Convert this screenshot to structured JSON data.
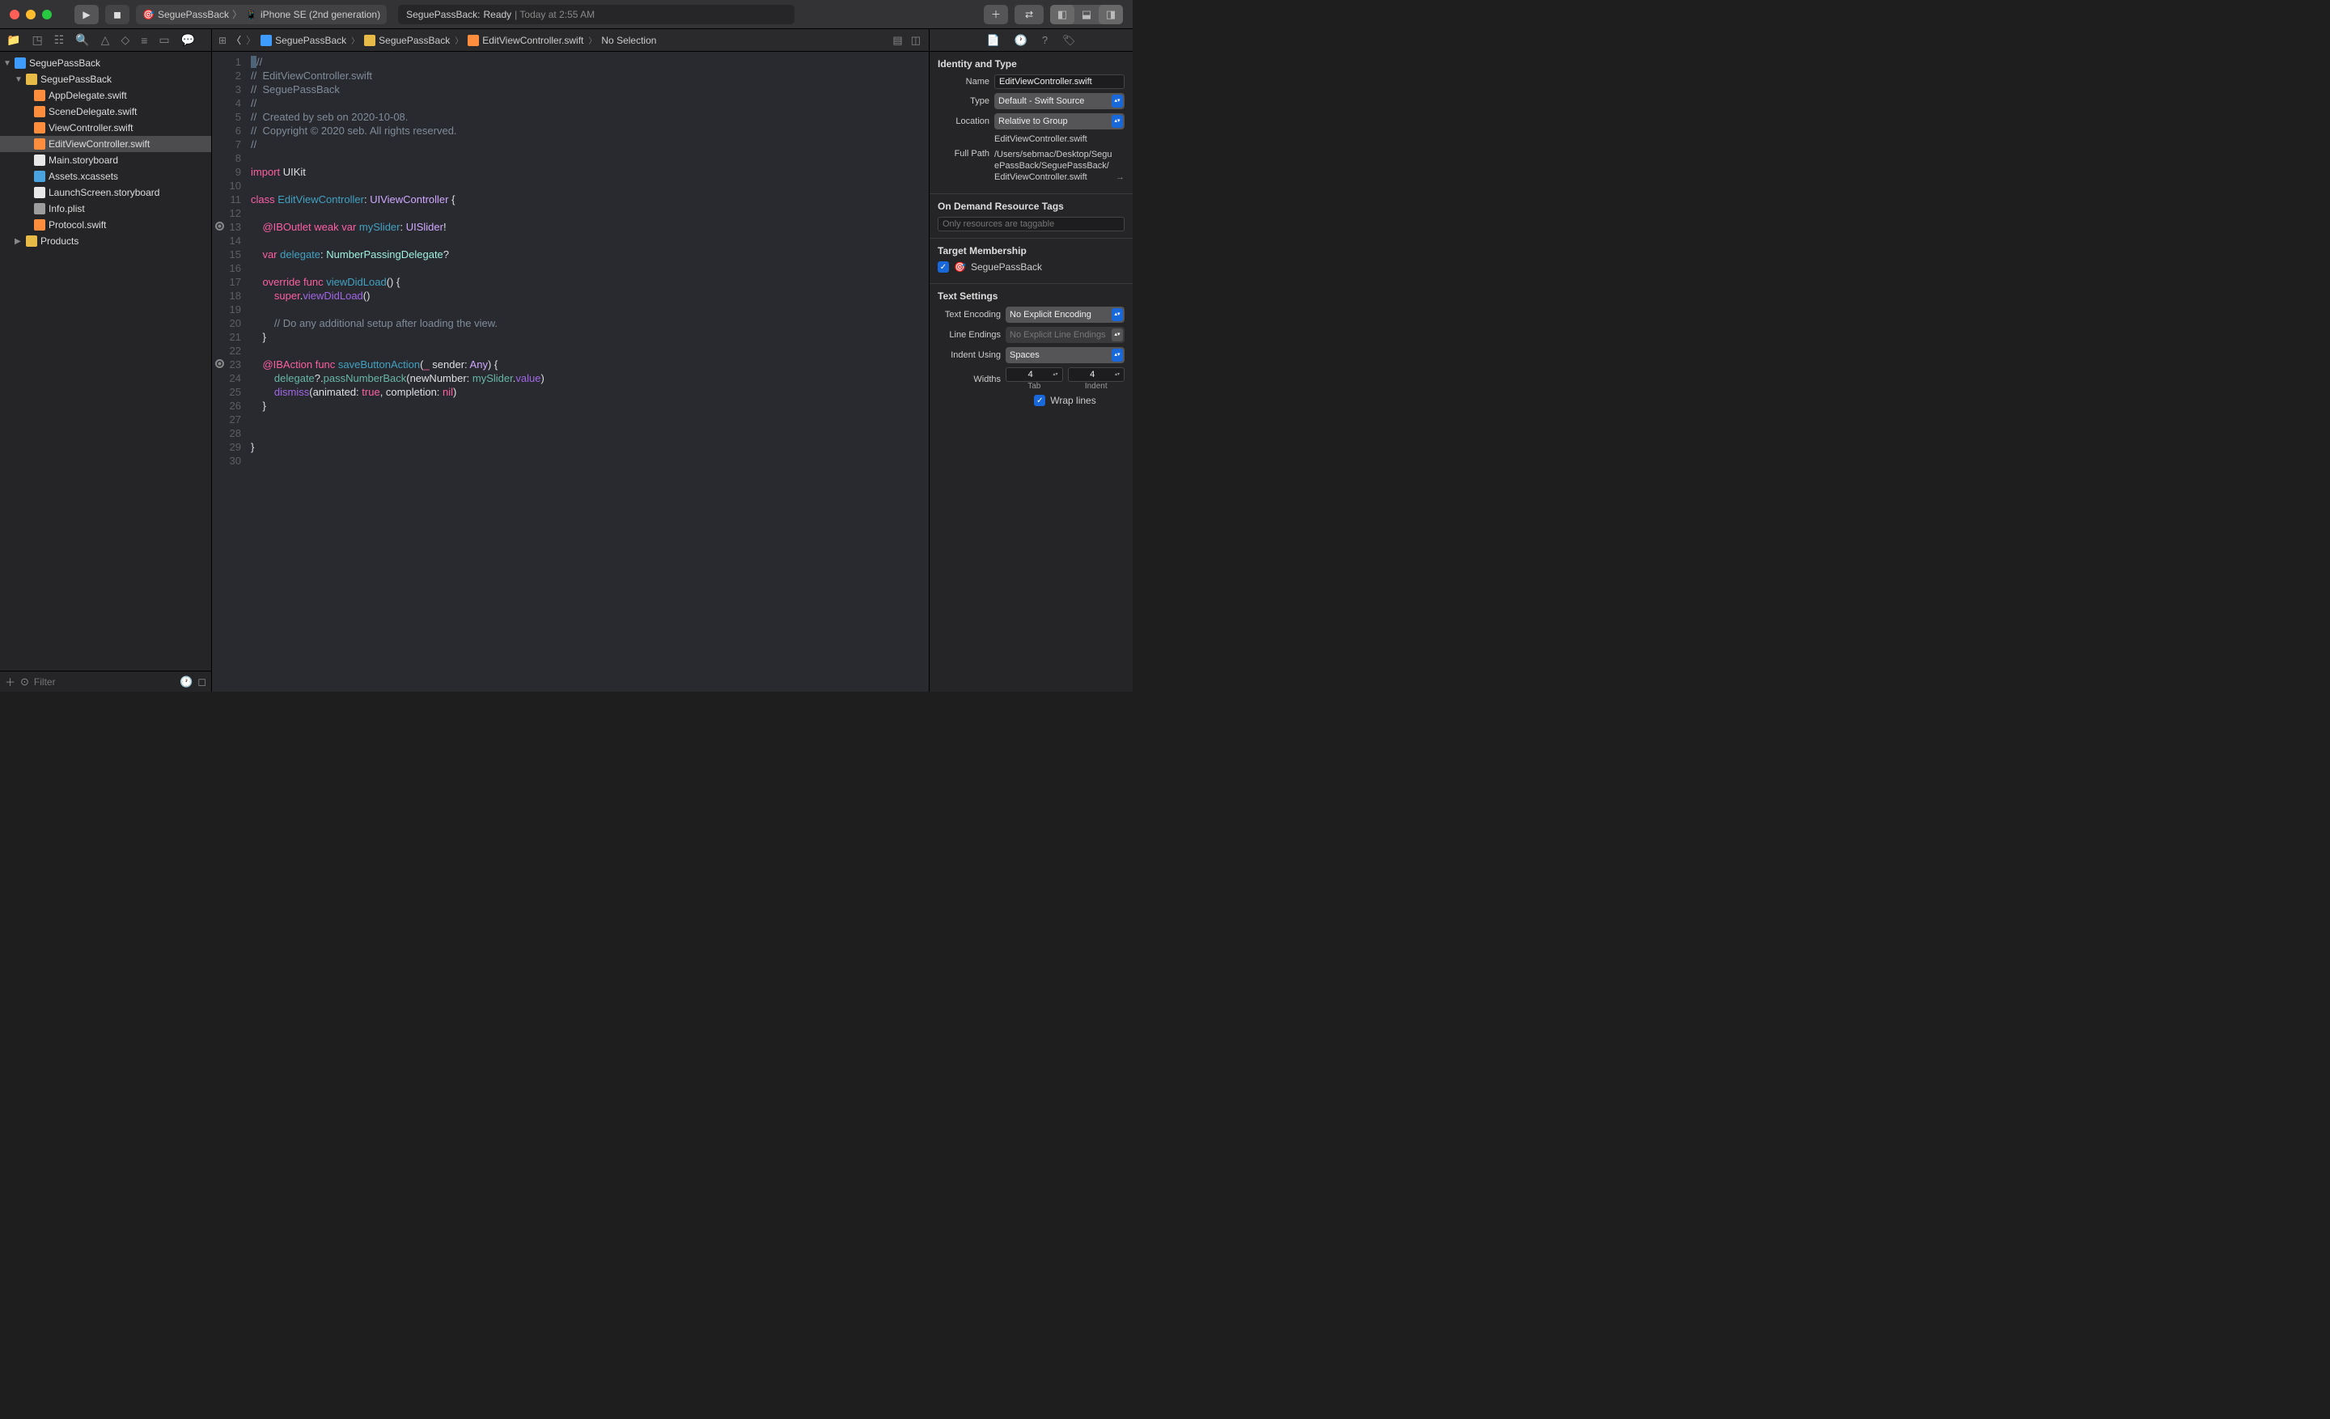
{
  "titlebar": {
    "scheme_target": "SeguePassBack",
    "scheme_device": "iPhone SE (2nd generation)",
    "status_project": "SeguePassBack:",
    "status_label": "Ready",
    "status_time": "| Today at 2:55 AM"
  },
  "jumpbar": {
    "items": [
      "SeguePassBack",
      "SeguePassBack",
      "EditViewController.swift",
      "No Selection"
    ]
  },
  "navigator": {
    "project": "SeguePassBack",
    "group": "SeguePassBack",
    "files": [
      {
        "name": "AppDelegate.swift",
        "icon": "swift"
      },
      {
        "name": "SceneDelegate.swift",
        "icon": "swift"
      },
      {
        "name": "ViewController.swift",
        "icon": "swift"
      },
      {
        "name": "EditViewController.swift",
        "icon": "swift",
        "selected": true
      },
      {
        "name": "Main.storyboard",
        "icon": "storyboard"
      },
      {
        "name": "Assets.xcassets",
        "icon": "assets"
      },
      {
        "name": "LaunchScreen.storyboard",
        "icon": "storyboard"
      },
      {
        "name": "Info.plist",
        "icon": "plist"
      },
      {
        "name": "Protocol.swift",
        "icon": "swift"
      }
    ],
    "products": "Products",
    "filter_placeholder": "Filter"
  },
  "code_lines": [
    {
      "n": 1,
      "segs": [
        [
          "",
          "cursor"
        ],
        [
          "//",
          "c-comment"
        ]
      ]
    },
    {
      "n": 2,
      "segs": [
        [
          "//  EditViewController.swift",
          "c-comment"
        ]
      ]
    },
    {
      "n": 3,
      "segs": [
        [
          "//  SeguePassBack",
          "c-comment"
        ]
      ]
    },
    {
      "n": 4,
      "segs": [
        [
          "//",
          "c-comment"
        ]
      ]
    },
    {
      "n": 5,
      "segs": [
        [
          "//  Created by seb on 2020-10-08.",
          "c-comment"
        ]
      ]
    },
    {
      "n": 6,
      "segs": [
        [
          "//  Copyright © 2020 seb. All rights reserved.",
          "c-comment"
        ]
      ]
    },
    {
      "n": 7,
      "segs": [
        [
          "//",
          "c-comment"
        ]
      ]
    },
    {
      "n": 8,
      "segs": []
    },
    {
      "n": 9,
      "segs": [
        [
          "import",
          "c-keyword"
        ],
        [
          " UIKit",
          ""
        ]
      ]
    },
    {
      "n": 10,
      "segs": []
    },
    {
      "n": 11,
      "segs": [
        [
          "class",
          "c-keyword"
        ],
        [
          " ",
          ""
        ],
        [
          "EditViewController",
          "c-funcdef"
        ],
        [
          ": ",
          ""
        ],
        [
          "UIViewController",
          "c-typestd"
        ],
        [
          " {",
          ""
        ]
      ]
    },
    {
      "n": 12,
      "segs": []
    },
    {
      "n": 13,
      "bp": true,
      "segs": [
        [
          "    ",
          ""
        ],
        [
          "@IBOutlet",
          "c-keyword"
        ],
        [
          " ",
          ""
        ],
        [
          "weak",
          "c-keyword"
        ],
        [
          " ",
          ""
        ],
        [
          "var",
          "c-keyword"
        ],
        [
          " ",
          ""
        ],
        [
          "mySlider",
          "c-funcdef"
        ],
        [
          ": ",
          ""
        ],
        [
          "UISlider",
          "c-typestd"
        ],
        [
          "!",
          ""
        ]
      ]
    },
    {
      "n": 14,
      "segs": [
        [
          "    ",
          ""
        ]
      ]
    },
    {
      "n": 15,
      "segs": [
        [
          "    ",
          ""
        ],
        [
          "var",
          "c-keyword"
        ],
        [
          " ",
          ""
        ],
        [
          "delegate",
          "c-funcdef"
        ],
        [
          ": ",
          ""
        ],
        [
          "NumberPassingDelegate",
          "c-type"
        ],
        [
          "?",
          ""
        ]
      ]
    },
    {
      "n": 16,
      "segs": [
        [
          "    ",
          ""
        ]
      ]
    },
    {
      "n": 17,
      "segs": [
        [
          "    ",
          ""
        ],
        [
          "override",
          "c-keyword"
        ],
        [
          " ",
          ""
        ],
        [
          "func",
          "c-keyword"
        ],
        [
          " ",
          ""
        ],
        [
          "viewDidLoad",
          "c-funcdef"
        ],
        [
          "() {",
          ""
        ]
      ]
    },
    {
      "n": 18,
      "segs": [
        [
          "        ",
          ""
        ],
        [
          "super",
          "c-keyword"
        ],
        [
          ".",
          ""
        ],
        [
          "viewDidLoad",
          "c-param"
        ],
        [
          "()",
          ""
        ]
      ]
    },
    {
      "n": 19,
      "segs": []
    },
    {
      "n": 20,
      "segs": [
        [
          "        ",
          ""
        ],
        [
          "// Do any additional setup after loading the view.",
          "c-comment"
        ]
      ]
    },
    {
      "n": 21,
      "segs": [
        [
          "    }",
          ""
        ]
      ]
    },
    {
      "n": 22,
      "segs": [
        [
          "    ",
          ""
        ]
      ]
    },
    {
      "n": 23,
      "bp": true,
      "segs": [
        [
          "    ",
          ""
        ],
        [
          "@IBAction",
          "c-keyword"
        ],
        [
          " ",
          ""
        ],
        [
          "func",
          "c-keyword"
        ],
        [
          " ",
          ""
        ],
        [
          "saveButtonAction",
          "c-funcdef"
        ],
        [
          "(",
          ""
        ],
        [
          "_",
          "c-keyword"
        ],
        [
          " sender: ",
          ""
        ],
        [
          "Any",
          "c-typestd"
        ],
        [
          ") {",
          ""
        ]
      ]
    },
    {
      "n": 24,
      "segs": [
        [
          "        ",
          ""
        ],
        [
          "delegate",
          "c-func"
        ],
        [
          "?.",
          ""
        ],
        [
          "passNumberBack",
          "c-func"
        ],
        [
          "(newNumber: ",
          ""
        ],
        [
          "mySlider",
          "c-func"
        ],
        [
          ".",
          ""
        ],
        [
          "value",
          "c-param"
        ],
        [
          ")",
          ""
        ]
      ]
    },
    {
      "n": 25,
      "segs": [
        [
          "        ",
          ""
        ],
        [
          "dismiss",
          "c-param"
        ],
        [
          "(animated: ",
          ""
        ],
        [
          "true",
          "c-keyword"
        ],
        [
          ", completion: ",
          ""
        ],
        [
          "nil",
          "c-keyword"
        ],
        [
          ")",
          ""
        ]
      ]
    },
    {
      "n": 26,
      "segs": [
        [
          "    }",
          ""
        ]
      ]
    },
    {
      "n": 27,
      "segs": [
        [
          "    ",
          ""
        ]
      ]
    },
    {
      "n": 28,
      "segs": [
        [
          "    ",
          ""
        ]
      ]
    },
    {
      "n": 29,
      "segs": [
        [
          "}",
          ""
        ]
      ]
    },
    {
      "n": 30,
      "segs": []
    }
  ],
  "inspector": {
    "identity_header": "Identity and Type",
    "name_label": "Name",
    "name_value": "EditViewController.swift",
    "type_label": "Type",
    "type_value": "Default - Swift Source",
    "location_label": "Location",
    "location_value": "Relative to Group",
    "location_file": "EditViewController.swift",
    "fullpath_label": "Full Path",
    "fullpath_value": "/Users/sebmac/Desktop/SeguePassBack/SeguePassBack/EditViewController.swift",
    "odr_header": "On Demand Resource Tags",
    "odr_placeholder": "Only resources are taggable",
    "target_header": "Target Membership",
    "target_name": "SeguePassBack",
    "text_header": "Text Settings",
    "enc_label": "Text Encoding",
    "enc_value": "No Explicit Encoding",
    "lineend_label": "Line Endings",
    "lineend_value": "No Explicit Line Endings",
    "indent_label": "Indent Using",
    "indent_value": "Spaces",
    "widths_label": "Widths",
    "tab_value": "4",
    "indent_value_n": "4",
    "tab_sublabel": "Tab",
    "indent_sublabel": "Indent",
    "wrap_label": "Wrap lines"
  }
}
